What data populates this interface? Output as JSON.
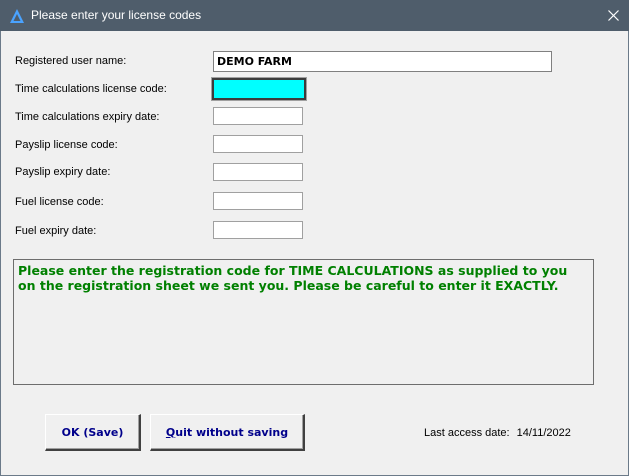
{
  "window": {
    "title": "Please enter your license codes",
    "title_bar_color": "#4f5d6b",
    "app_icon": "triangle-logo-icon",
    "close_icon": "close-icon"
  },
  "form": {
    "registered_user_label": "Registered user name:",
    "registered_user_value": "DEMO FARM",
    "time_license_label": "Time calculations license code:",
    "time_license_value": "",
    "time_expiry_label": "Time calculations expiry date:",
    "time_expiry_value": "",
    "payslip_license_label": "Payslip license code:",
    "payslip_license_value": "",
    "payslip_expiry_label": "Payslip expiry date:",
    "payslip_expiry_value": "",
    "fuel_license_label": "Fuel license code:",
    "fuel_license_value": "",
    "fuel_expiry_label": "Fuel expiry date:",
    "fuel_expiry_value": "",
    "active_field_color": "#00ffff"
  },
  "message": {
    "text": "Please enter the registration code for TIME CALCULATIONS as supplied to you on the registration sheet we sent you. Please be careful to enter it EXACTLY.",
    "color": "#008000"
  },
  "buttons": {
    "ok_label": "OK (Save)",
    "quit_label_first": "Q",
    "quit_label_rest": "uit without saving",
    "label_color": "#00008b"
  },
  "footer": {
    "last_access_label": "Last access date:",
    "last_access_value": "14/11/2022"
  }
}
